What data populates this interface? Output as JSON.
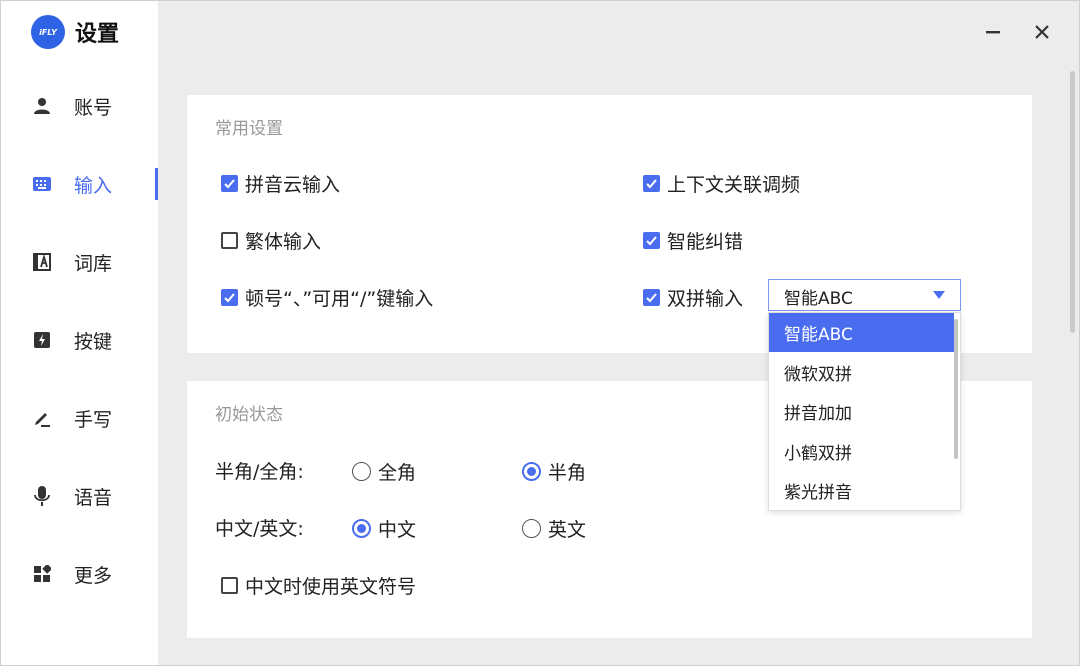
{
  "app": {
    "logo_text": "iFLY",
    "title": "设置"
  },
  "window_controls": {
    "minimize_icon": "minimize-icon",
    "close_icon": "close-icon"
  },
  "sidebar": {
    "items": [
      {
        "label": "账号",
        "icon": "user-icon"
      },
      {
        "label": "输入",
        "icon": "keyboard-icon",
        "active": true
      },
      {
        "label": "词库",
        "icon": "dictionary-icon"
      },
      {
        "label": "按键",
        "icon": "key-icon"
      },
      {
        "label": "手写",
        "icon": "pen-icon"
      },
      {
        "label": "语音",
        "icon": "mic-icon"
      },
      {
        "label": "更多",
        "icon": "grid-icon"
      }
    ]
  },
  "common": {
    "title": "常用设置",
    "pinyin_cloud": {
      "label": "拼音云输入",
      "checked": true
    },
    "context_freq": {
      "label": "上下文关联调频",
      "checked": true
    },
    "traditional": {
      "label": "繁体输入",
      "checked": false
    },
    "smart_correct": {
      "label": "智能纠错",
      "checked": true
    },
    "dunhao": {
      "label": "顿号“、”可用“/”键输入",
      "checked": true
    },
    "shuangpin": {
      "label": "双拼输入",
      "checked": true
    },
    "shuangpin_select": {
      "value": "智能ABC",
      "options": [
        "智能ABC",
        "微软双拼",
        "拼音加加",
        "小鹤双拼",
        "紫光拼音"
      ],
      "highlighted": "智能ABC"
    }
  },
  "initial": {
    "title": "初始状态",
    "width_mode": {
      "label": "半角/全角:",
      "options": [
        "全角",
        "半角"
      ],
      "selected": "半角"
    },
    "lang_mode": {
      "label": "中文/英文:",
      "options": [
        "中文",
        "英文"
      ],
      "selected": "中文"
    },
    "english_symbols": {
      "label": "中文时使用英文符号",
      "checked": false
    }
  },
  "colors": {
    "accent": "#4a6df0",
    "logo": "#2f63e6",
    "background": "#ececec"
  }
}
